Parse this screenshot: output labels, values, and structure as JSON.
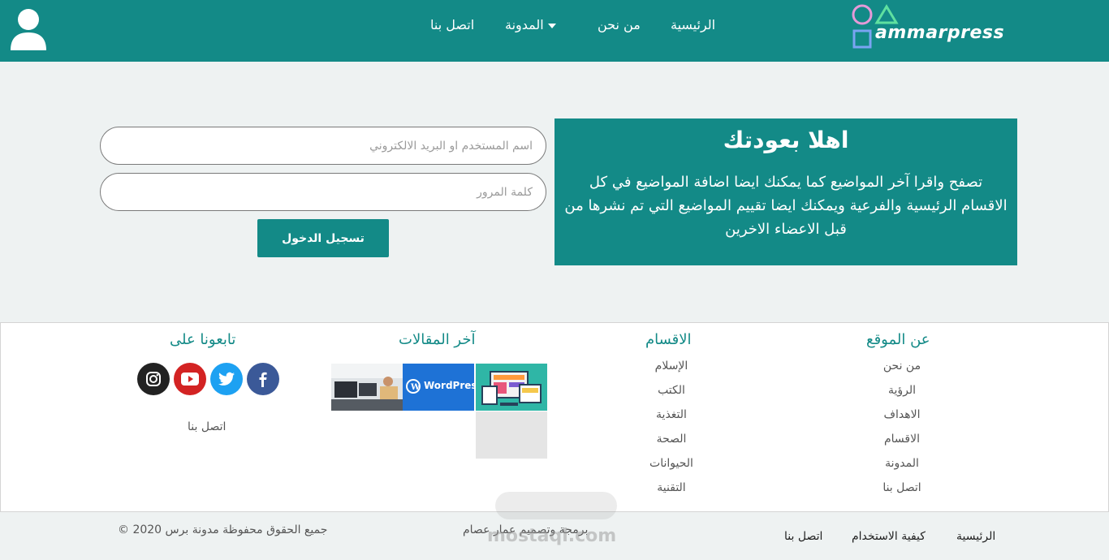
{
  "header": {
    "logo_text": "ammarpress",
    "nav": {
      "home": "الرئيسية",
      "about": "من نحن",
      "blog": "المدونة",
      "contact": "اتصل بنا"
    }
  },
  "login": {
    "username_placeholder": "اسم المستخدم او البريد الالكتروني",
    "password_placeholder": "كلمة المرور",
    "submit_label": "تسجيل الدخول"
  },
  "welcome": {
    "title": "اهلا بعودتك",
    "text": "تصفح واقرا آخر المواضيع كما يمكنك ايضا اضافة المواضيع في كل الاقسام الرئيسية والفرعية ويمكنك ايضا تقييم المواضيع التي تم نشرها من قبل الاعضاء الاخرين"
  },
  "footer": {
    "about": {
      "title": "عن الموقع",
      "links": [
        "من نحن",
        "الرؤية",
        "الاهداف",
        "الاقسام",
        "المدونة",
        "اتصل بنا"
      ]
    },
    "categories": {
      "title": "الاقسام",
      "links": [
        "الإسلام",
        "الكتب",
        "التغذية",
        "الصحة",
        "الحيوانات",
        "التقنية"
      ]
    },
    "latest": {
      "title": "آخر المقالات",
      "wordpress_label": "WordPress"
    },
    "follow": {
      "title": "تابعونا على",
      "contact": "اتصل بنا",
      "icons": [
        "facebook-icon",
        "twitter-icon",
        "youtube-icon",
        "instagram-icon"
      ]
    }
  },
  "bottom": {
    "copyright": "جميع الحقوق محفوظة مدونة برس 2020 ©",
    "credit": "برمجة وتصميم عمار عصام",
    "links": {
      "home": "الرئيسية",
      "howto": "كيفية الاستخدام",
      "contact": "اتصل بنا"
    },
    "watermark": "mostaql.com"
  },
  "colors": {
    "primary": "#138a87",
    "facebook": "#3b5998",
    "twitter": "#1da1f2",
    "youtube": "#d32323",
    "instagram": "#222222"
  }
}
